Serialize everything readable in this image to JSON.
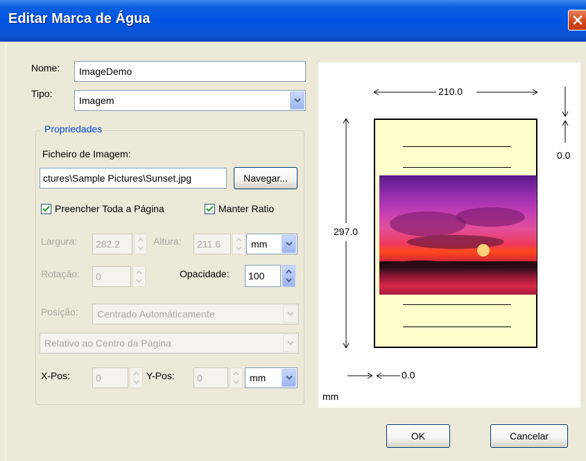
{
  "dialog": {
    "title": "Editar Marca de Água"
  },
  "form": {
    "name_label": "Nome:",
    "name_value": "ImageDemo",
    "type_label": "Tipo:",
    "type_value": "Imagem",
    "group_title": "Propriedades",
    "image_file_label": "Ficheiro de Imagem:",
    "image_file_value": "ctures\\Sample Pictures\\Sunset.jpg",
    "browse_label": "Navegar...",
    "fill_page_label": "Preencher Toda a Página",
    "fill_page_checked": true,
    "keep_ratio_label": "Manter Ratio",
    "keep_ratio_checked": true,
    "width_label": "Largura:",
    "width_value": "282.2",
    "height_label": "Altura:",
    "height_value": "211.6",
    "size_unit": "mm",
    "rotation_label": "Rotação:",
    "rotation_value": "0",
    "opacity_label": "Opacidade:",
    "opacity_value": "100",
    "position_label": "Posição:",
    "position_value": "Centrado Automáticamente",
    "relative_value": "Relativo ao Centro da Página",
    "xpos_label": "X-Pos:",
    "xpos_value": "0",
    "ypos_label": "Y-Pos:",
    "ypos_value": "0",
    "pos_unit": "mm"
  },
  "preview": {
    "width_dim": "210.0",
    "height_dim": "297.0",
    "top_offset": "0.0",
    "left_offset": "0.0",
    "unit": "mm"
  },
  "buttons": {
    "ok": "OK",
    "cancel": "Cancelar"
  },
  "colors": {
    "title_bar": "#0054E3",
    "group_title": "#0046D5",
    "page_fill": "#FFFFCC"
  }
}
